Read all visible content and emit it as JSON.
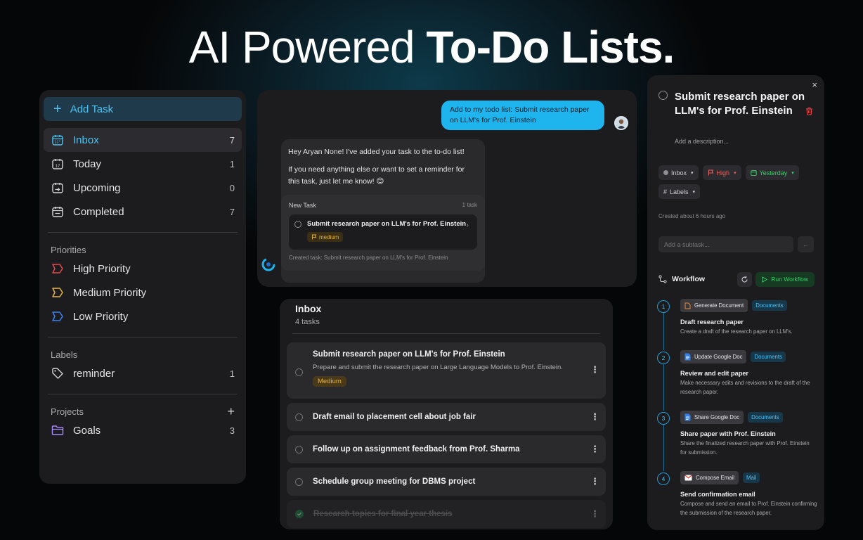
{
  "hero": {
    "light": "AI Powered ",
    "bold": "To-Do Lists."
  },
  "sidebar": {
    "add_task": "Add Task",
    "nav": [
      {
        "label": "Inbox",
        "count": "7",
        "icon": "inbox-calendar-icon"
      },
      {
        "label": "Today",
        "count": "1",
        "icon": "calendar-17-icon"
      },
      {
        "label": "Upcoming",
        "count": "0",
        "icon": "calendar-arrow-icon"
      },
      {
        "label": "Completed",
        "count": "7",
        "icon": "calendar-check-icon"
      }
    ],
    "priorities_title": "Priorities",
    "priorities": [
      {
        "label": "High Priority",
        "color": "#e5484d"
      },
      {
        "label": "Medium Priority",
        "color": "#e2b443"
      },
      {
        "label": "Low Priority",
        "color": "#3b82f6"
      }
    ],
    "labels_title": "Labels",
    "labels": [
      {
        "label": "reminder",
        "count": "1"
      }
    ],
    "projects_title": "Projects",
    "projects_add": "+",
    "projects": [
      {
        "label": "Goals",
        "count": "3",
        "color": "#a78bfa"
      }
    ]
  },
  "chat": {
    "user_message": "Add to my todo list: Submit research paper on LLM's for Prof. Einstein",
    "bot_line1": "Hey Aryan None! I've added your task to the to-do list!",
    "bot_line2": "If you need anything else or want to set a reminder for this task, just let me know! 😊",
    "card_title": "New Task",
    "card_count": "1 task",
    "card_task": "Submit research paper on LLM's for Prof. Einstein",
    "card_priority": "medium",
    "created_line": "Created task: Submit research paper on LLM's for Prof. Einstein"
  },
  "inbox": {
    "title": "Inbox",
    "subtitle": "4 tasks",
    "tasks": [
      {
        "title": "Submit research paper on LLM's for Prof. Einstein",
        "desc": "Prepare and submit the research paper on Large Language Models to Prof. Einstein.",
        "priority": "Medium"
      },
      {
        "title": "Draft email to placement cell about job fair"
      },
      {
        "title": "Follow up on assignment feedback from Prof. Sharma"
      },
      {
        "title": "Schedule group meeting for DBMS project"
      },
      {
        "title": "Research topics for final year thesis",
        "done": true
      }
    ]
  },
  "detail": {
    "close": "×",
    "title": "Submit research paper on LLM's for Prof. Einstein",
    "desc_placeholder": "Add a description...",
    "chips": {
      "project": "Inbox",
      "priority": "High",
      "due": "Yesterday",
      "labels": "Labels"
    },
    "created": "Created about 6 hours ago",
    "subtask_placeholder": "Add a subtask...",
    "workflow_title": "Workflow",
    "run_label": "Run Workflow",
    "steps": [
      {
        "num": "1",
        "tool": "Generate Document",
        "tag": "Documents",
        "title": "Draft research paper",
        "desc": "Create a draft of the research paper on LLM's."
      },
      {
        "num": "2",
        "tool": "Update Google Doc",
        "tag": "Documents",
        "title": "Review and edit paper",
        "desc": "Make necessary edits and revisions to the draft of the research paper."
      },
      {
        "num": "3",
        "tool": "Share Google Doc",
        "tag": "Documents",
        "title": "Share paper with Prof. Einstein",
        "desc": "Share the finalized research paper with Prof. Einstein for submission."
      },
      {
        "num": "4",
        "tool": "Compose Email",
        "tag": "Mail",
        "title": "Send confirmation email",
        "desc": "Compose and send an email to Prof. Einstein confirming the submission of the research paper."
      }
    ]
  }
}
